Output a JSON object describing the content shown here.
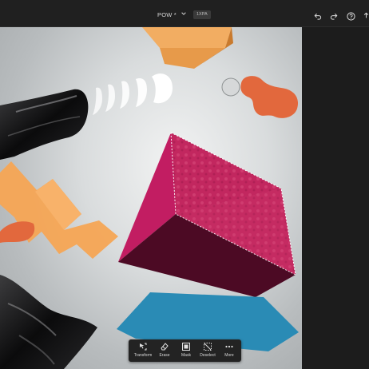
{
  "document": {
    "title": "POW *",
    "badge": "1XPA"
  },
  "header": {
    "icons": [
      "chevron-down-icon",
      "undo-icon",
      "redo-icon",
      "help-icon",
      "share-icon"
    ]
  },
  "toolbar": {
    "transform_label": "Transform",
    "erase_label": "Erase",
    "mask_label": "Mask",
    "deselect_label": "Deselect",
    "more_label": "More"
  },
  "colors": {
    "magenta_cube": "#b01a5b",
    "blue_shape": "#2a8bb5",
    "orange": "#f2a04a",
    "coral": "#e66a3c",
    "ui_dark": "#202020"
  }
}
